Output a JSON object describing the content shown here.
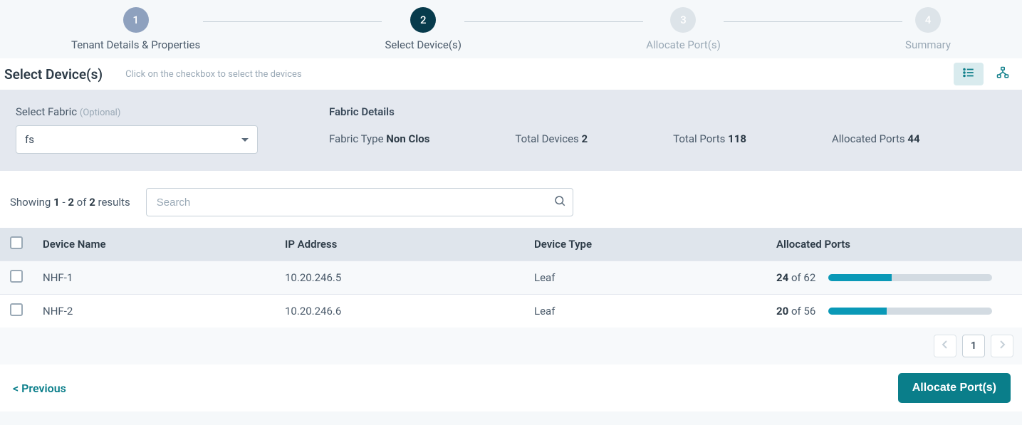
{
  "stepper": {
    "steps": [
      {
        "num": "1",
        "label": "Tenant Details & Properties",
        "state": "done"
      },
      {
        "num": "2",
        "label": "Select Device(s)",
        "state": "active"
      },
      {
        "num": "3",
        "label": "Allocate Port(s)",
        "state": "future"
      },
      {
        "num": "4",
        "label": "Summary",
        "state": "future"
      }
    ]
  },
  "section": {
    "title": "Select Device(s)",
    "hint": "Click on the checkbox to select the devices"
  },
  "fabric": {
    "select_label": "Select Fabric",
    "select_optional": "(Optional)",
    "selected_value": "fs",
    "details_title": "Fabric Details",
    "type_label": "Fabric Type",
    "type_value": "Non Clos",
    "total_devices_label": "Total Devices",
    "total_devices_value": "2",
    "total_ports_label": "Total Ports",
    "total_ports_value": "118",
    "allocated_ports_label": "Allocated Ports",
    "allocated_ports_value": "44"
  },
  "results": {
    "prefix": "Showing",
    "from": "1",
    "dash": "-",
    "to": "2",
    "of_word": "of",
    "total": "2",
    "suffix": "results",
    "search_placeholder": "Search"
  },
  "table": {
    "headers": {
      "device_name": "Device Name",
      "ip_address": "IP Address",
      "device_type": "Device Type",
      "allocated_ports": "Allocated Ports"
    },
    "rows": [
      {
        "name": "NHF-1",
        "ip": "10.20.246.5",
        "type": "Leaf",
        "alloc_used": "24",
        "alloc_total": "62",
        "pct": 38.7
      },
      {
        "name": "NHF-2",
        "ip": "10.20.246.6",
        "type": "Leaf",
        "alloc_used": "20",
        "alloc_total": "56",
        "pct": 35.7
      }
    ],
    "of_word": "of"
  },
  "pagination": {
    "current": "1"
  },
  "footer": {
    "previous": "< Previous",
    "allocate": "Allocate Port(s)"
  },
  "colors": {
    "step_done": "#8ea1be",
    "step_active": "#073b4c",
    "step_future": "#dde4e9",
    "accent": "#0a7e8a",
    "progress": "#0a99b7"
  }
}
